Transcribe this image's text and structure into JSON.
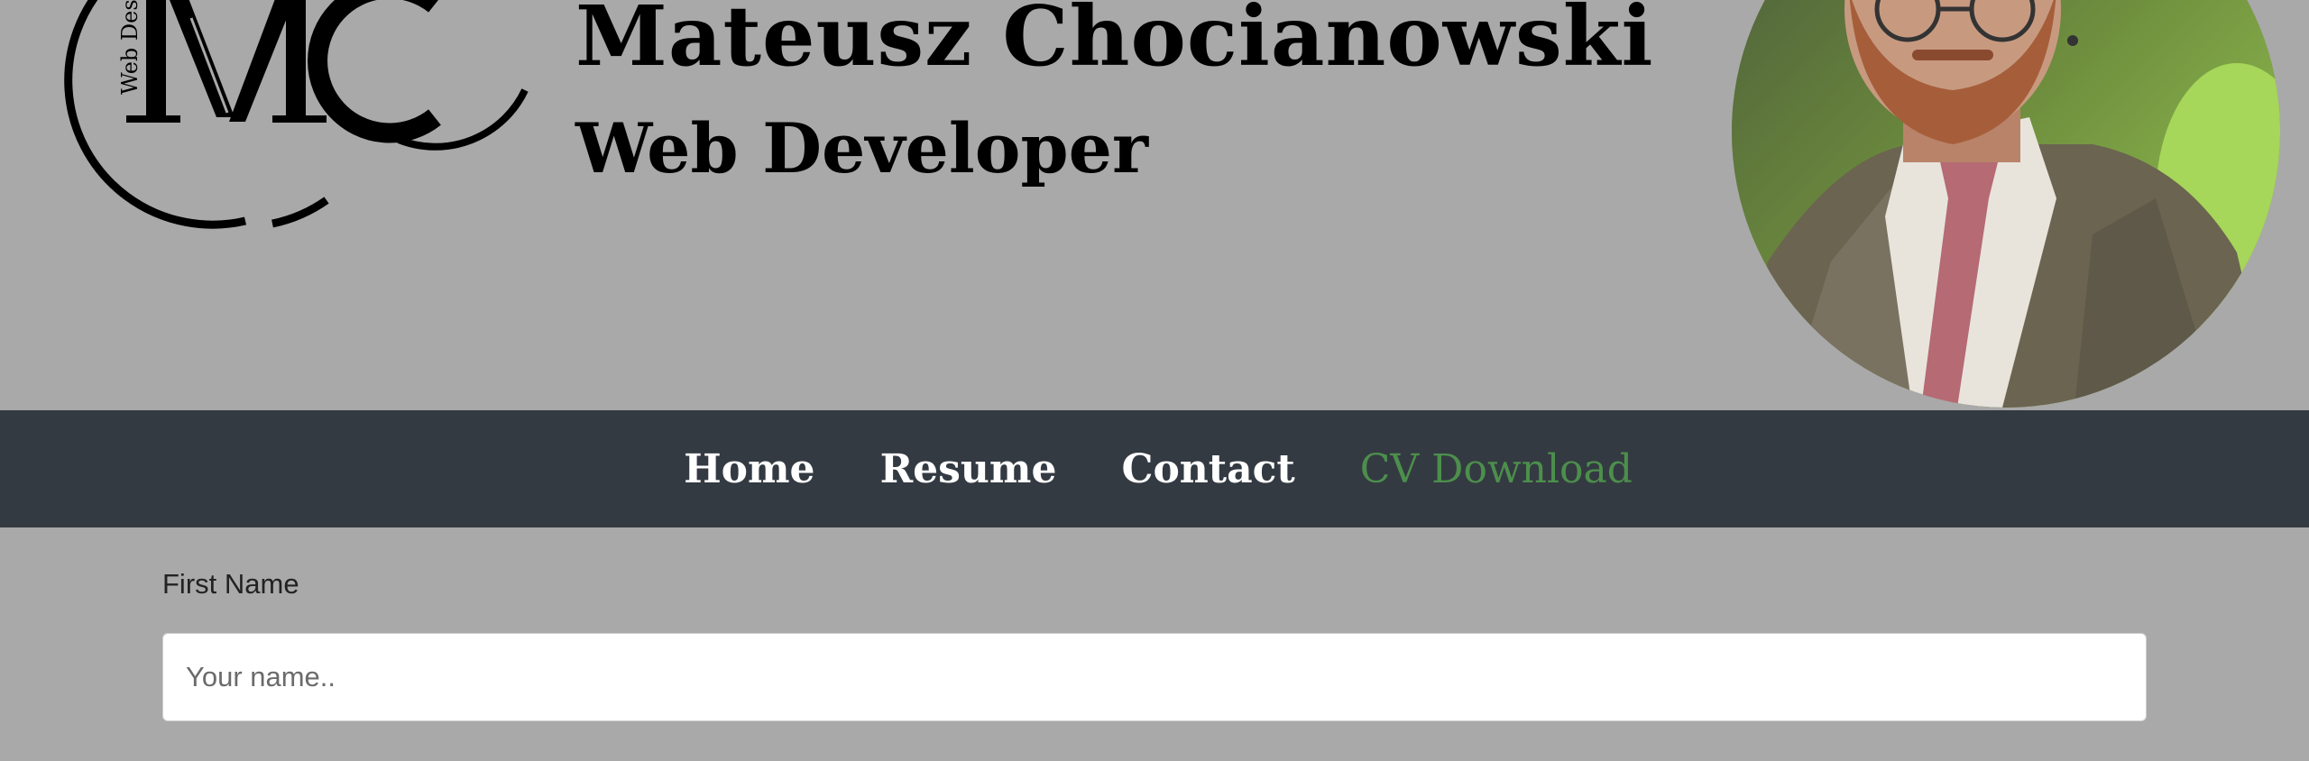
{
  "header": {
    "name": "Mateusz Chocianowski",
    "role": "Web Developer",
    "logo": {
      "tagline": "Web Desi",
      "icon": "mc-monogram-logo"
    },
    "avatar": {
      "icon": "profile-photo"
    }
  },
  "nav": {
    "items": [
      {
        "label": "Home"
      },
      {
        "label": "Resume"
      },
      {
        "label": "Contact"
      },
      {
        "label": "CV Download"
      }
    ],
    "accent_color": "#4c8f4c",
    "background": "#343a42"
  },
  "form": {
    "first_name": {
      "label": "First Name",
      "placeholder": "Your name..",
      "value": ""
    }
  },
  "colors": {
    "page_background": "#a9a9a9"
  }
}
